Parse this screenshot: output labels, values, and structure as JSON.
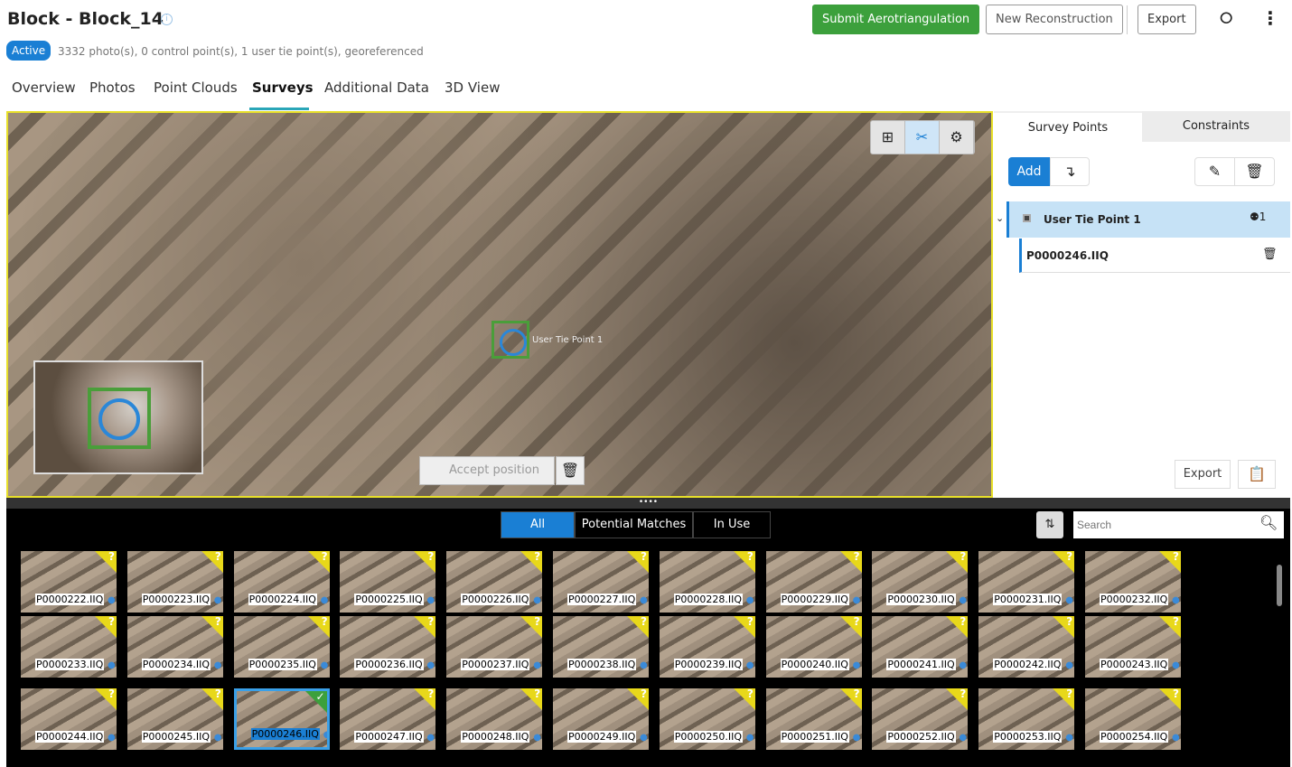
{
  "header": {
    "title": "Block -  Block_14",
    "status": "Active",
    "summary": "3332 photo(s), 0 control point(s), 1 user tie point(s), georeferenced",
    "submit": "Submit Aerotriangulation",
    "new_reconstruction": "New Reconstruction",
    "export": "Export"
  },
  "nav": [
    "Overview",
    "Photos",
    "Point Clouds",
    "Surveys",
    "Additional Data",
    "3D View"
  ],
  "viewer": {
    "marker_label": "User Tie Point 1",
    "accept": "Accept position"
  },
  "panel": {
    "tabs": [
      "Survey Points",
      "Constraints"
    ],
    "add": "Add",
    "point": "User Tie Point 1",
    "point_count": "1",
    "photo": "P0000246.IIQ",
    "export": "Export"
  },
  "filmstrip": {
    "filters": [
      "All",
      "Potential Matches",
      "In Use"
    ],
    "active_filter": "All",
    "search_placeholder": "Search",
    "photos": [
      "P0000222.IIQ",
      "P0000223.IIQ",
      "P0000224.IIQ",
      "P0000225.IIQ",
      "P0000226.IIQ",
      "P0000227.IIQ",
      "P0000228.IIQ",
      "P0000229.IIQ",
      "P0000230.IIQ",
      "P0000231.IIQ",
      "P0000232.IIQ",
      "P0000233.IIQ",
      "P0000234.IIQ",
      "P0000235.IIQ",
      "P0000236.IIQ",
      "P0000237.IIQ",
      "P0000238.IIQ",
      "P0000239.IIQ",
      "P0000240.IIQ",
      "P0000241.IIQ",
      "P0000242.IIQ",
      "P0000243.IIQ",
      "P0000244.IIQ",
      "P0000245.IIQ",
      "P0000246.IIQ",
      "P0000247.IIQ",
      "P0000248.IIQ",
      "P0000249.IIQ",
      "P0000250.IIQ",
      "P0000251.IIQ",
      "P0000252.IIQ",
      "P0000253.IIQ",
      "P0000254.IIQ"
    ],
    "selected": "P0000246.IIQ"
  }
}
